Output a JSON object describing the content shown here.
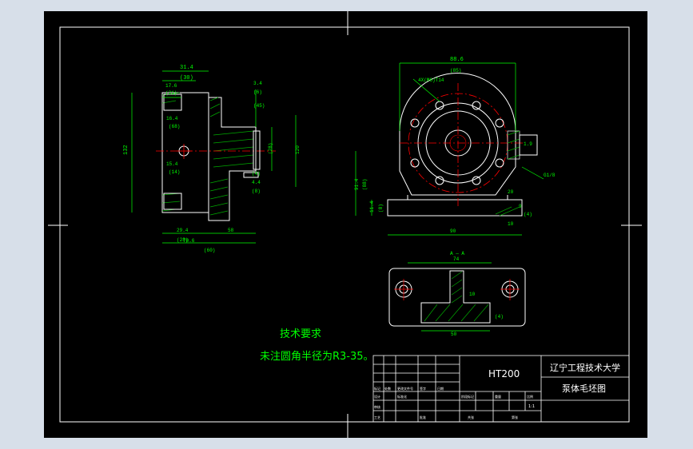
{
  "drawing": {
    "left_view": {
      "dims_top": [
        "31.4",
        "(30)",
        "17.6",
        "(21)",
        "16.4",
        "(68)",
        "15.4",
        "(14)"
      ],
      "dim_left": "132",
      "dims_right": [
        "3.4",
        "(6)",
        "(45)",
        "(28)",
        "120",
        "(4)",
        "4.4",
        "(8)"
      ],
      "dims_bottom": [
        "29.4",
        "(28)",
        "70.6",
        "58",
        "(60)"
      ]
    },
    "right_view": {
      "dim_top": "88.6",
      "dim_top_sub": "(85)",
      "hole_note": "4X(M6)T14",
      "dims_left": [
        "91.4",
        "(88)",
        "11.4",
        "(8)"
      ],
      "dim_bottom": "90",
      "dim_right": "G1/8",
      "small_dims": [
        "20",
        "9",
        "10",
        "1.9",
        "(4)"
      ]
    },
    "section": {
      "label": "A — A",
      "dim_top": "74",
      "dim_middle": "10",
      "dim_bottom": "50",
      "dim_side": "(4)"
    },
    "notes": {
      "heading": "技术要求",
      "line1": "未注圆角半径为R3-35。"
    }
  },
  "title_block": {
    "material": "HT200",
    "school": "辽宁工程技术大学",
    "part_name": "泵体毛坯图",
    "scale": "1:1",
    "small_labels": [
      "标记",
      "处数",
      "更改文件号",
      "签字",
      "日期",
      "设计",
      "标准化",
      "阶段标记",
      "重量",
      "比例",
      "审核",
      "工艺",
      "批准",
      "共张",
      "第张"
    ]
  },
  "colors": {
    "background": "#000000",
    "outline": "#ffffff",
    "dimension": "#00ff00",
    "centerline": "#ff0000",
    "hatch": "#00ff00"
  }
}
